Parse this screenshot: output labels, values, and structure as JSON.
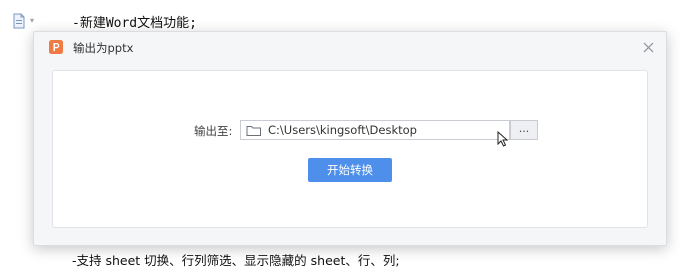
{
  "document": {
    "line1": "-新建Word文档功能;",
    "line2": "-支持 sheet 切换、行列筛选、显示隐藏的 sheet、行、列;"
  },
  "dialog": {
    "title": "输出为pptx",
    "output_label": "输出至:",
    "path_value": "C:\\Users\\kingsoft\\Desktop",
    "browse_label": "...",
    "start_label": "开始转换"
  },
  "icons": {
    "doc": "document-icon",
    "app": "wps-presentation-icon",
    "close": "close-icon",
    "folder": "folder-icon",
    "cursor": "mouse-cursor-icon"
  },
  "colors": {
    "accent": "#4d8fea",
    "app_icon": "#f07a43"
  }
}
